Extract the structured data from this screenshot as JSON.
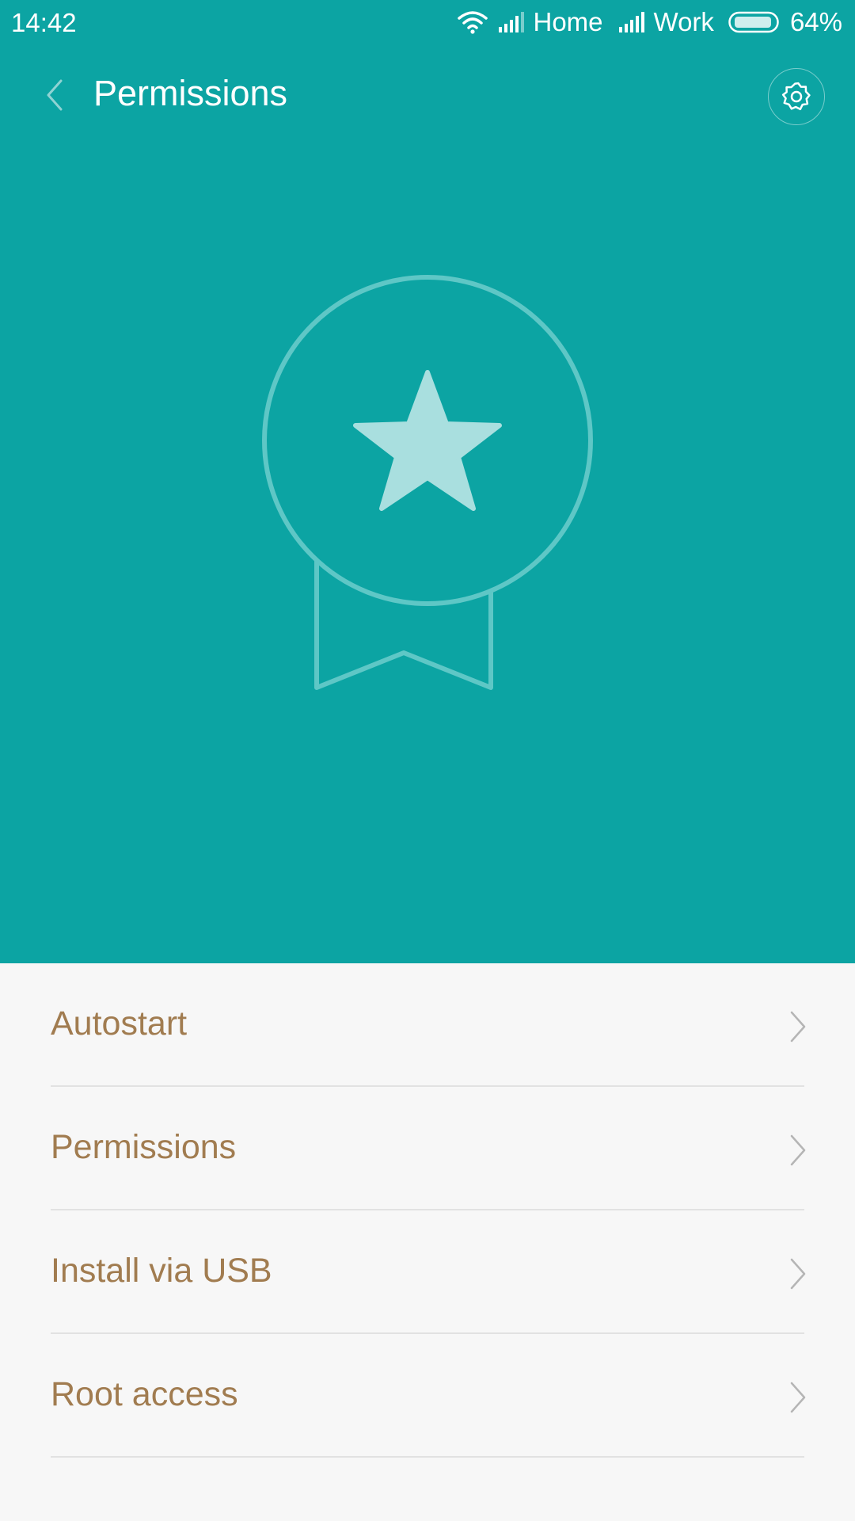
{
  "status_bar": {
    "time": "14:42",
    "sim1": "Home",
    "sim2": "Work",
    "battery_percent": "64%",
    "battery_level": 0.64,
    "icons": [
      "wifi-icon",
      "signal-icon",
      "signal-icon",
      "battery-icon"
    ]
  },
  "app_bar": {
    "title": "Permissions",
    "back_icon": "chevron-left-icon",
    "settings_icon": "gear-icon"
  },
  "hero": {
    "illustration": "award-badge-star-icon",
    "background_color": "#0ca4a3"
  },
  "menu": {
    "items": [
      {
        "label": "Autostart"
      },
      {
        "label": "Permissions"
      },
      {
        "label": "Install via USB"
      },
      {
        "label": "Root access"
      }
    ],
    "label_color": "#a17c50"
  }
}
